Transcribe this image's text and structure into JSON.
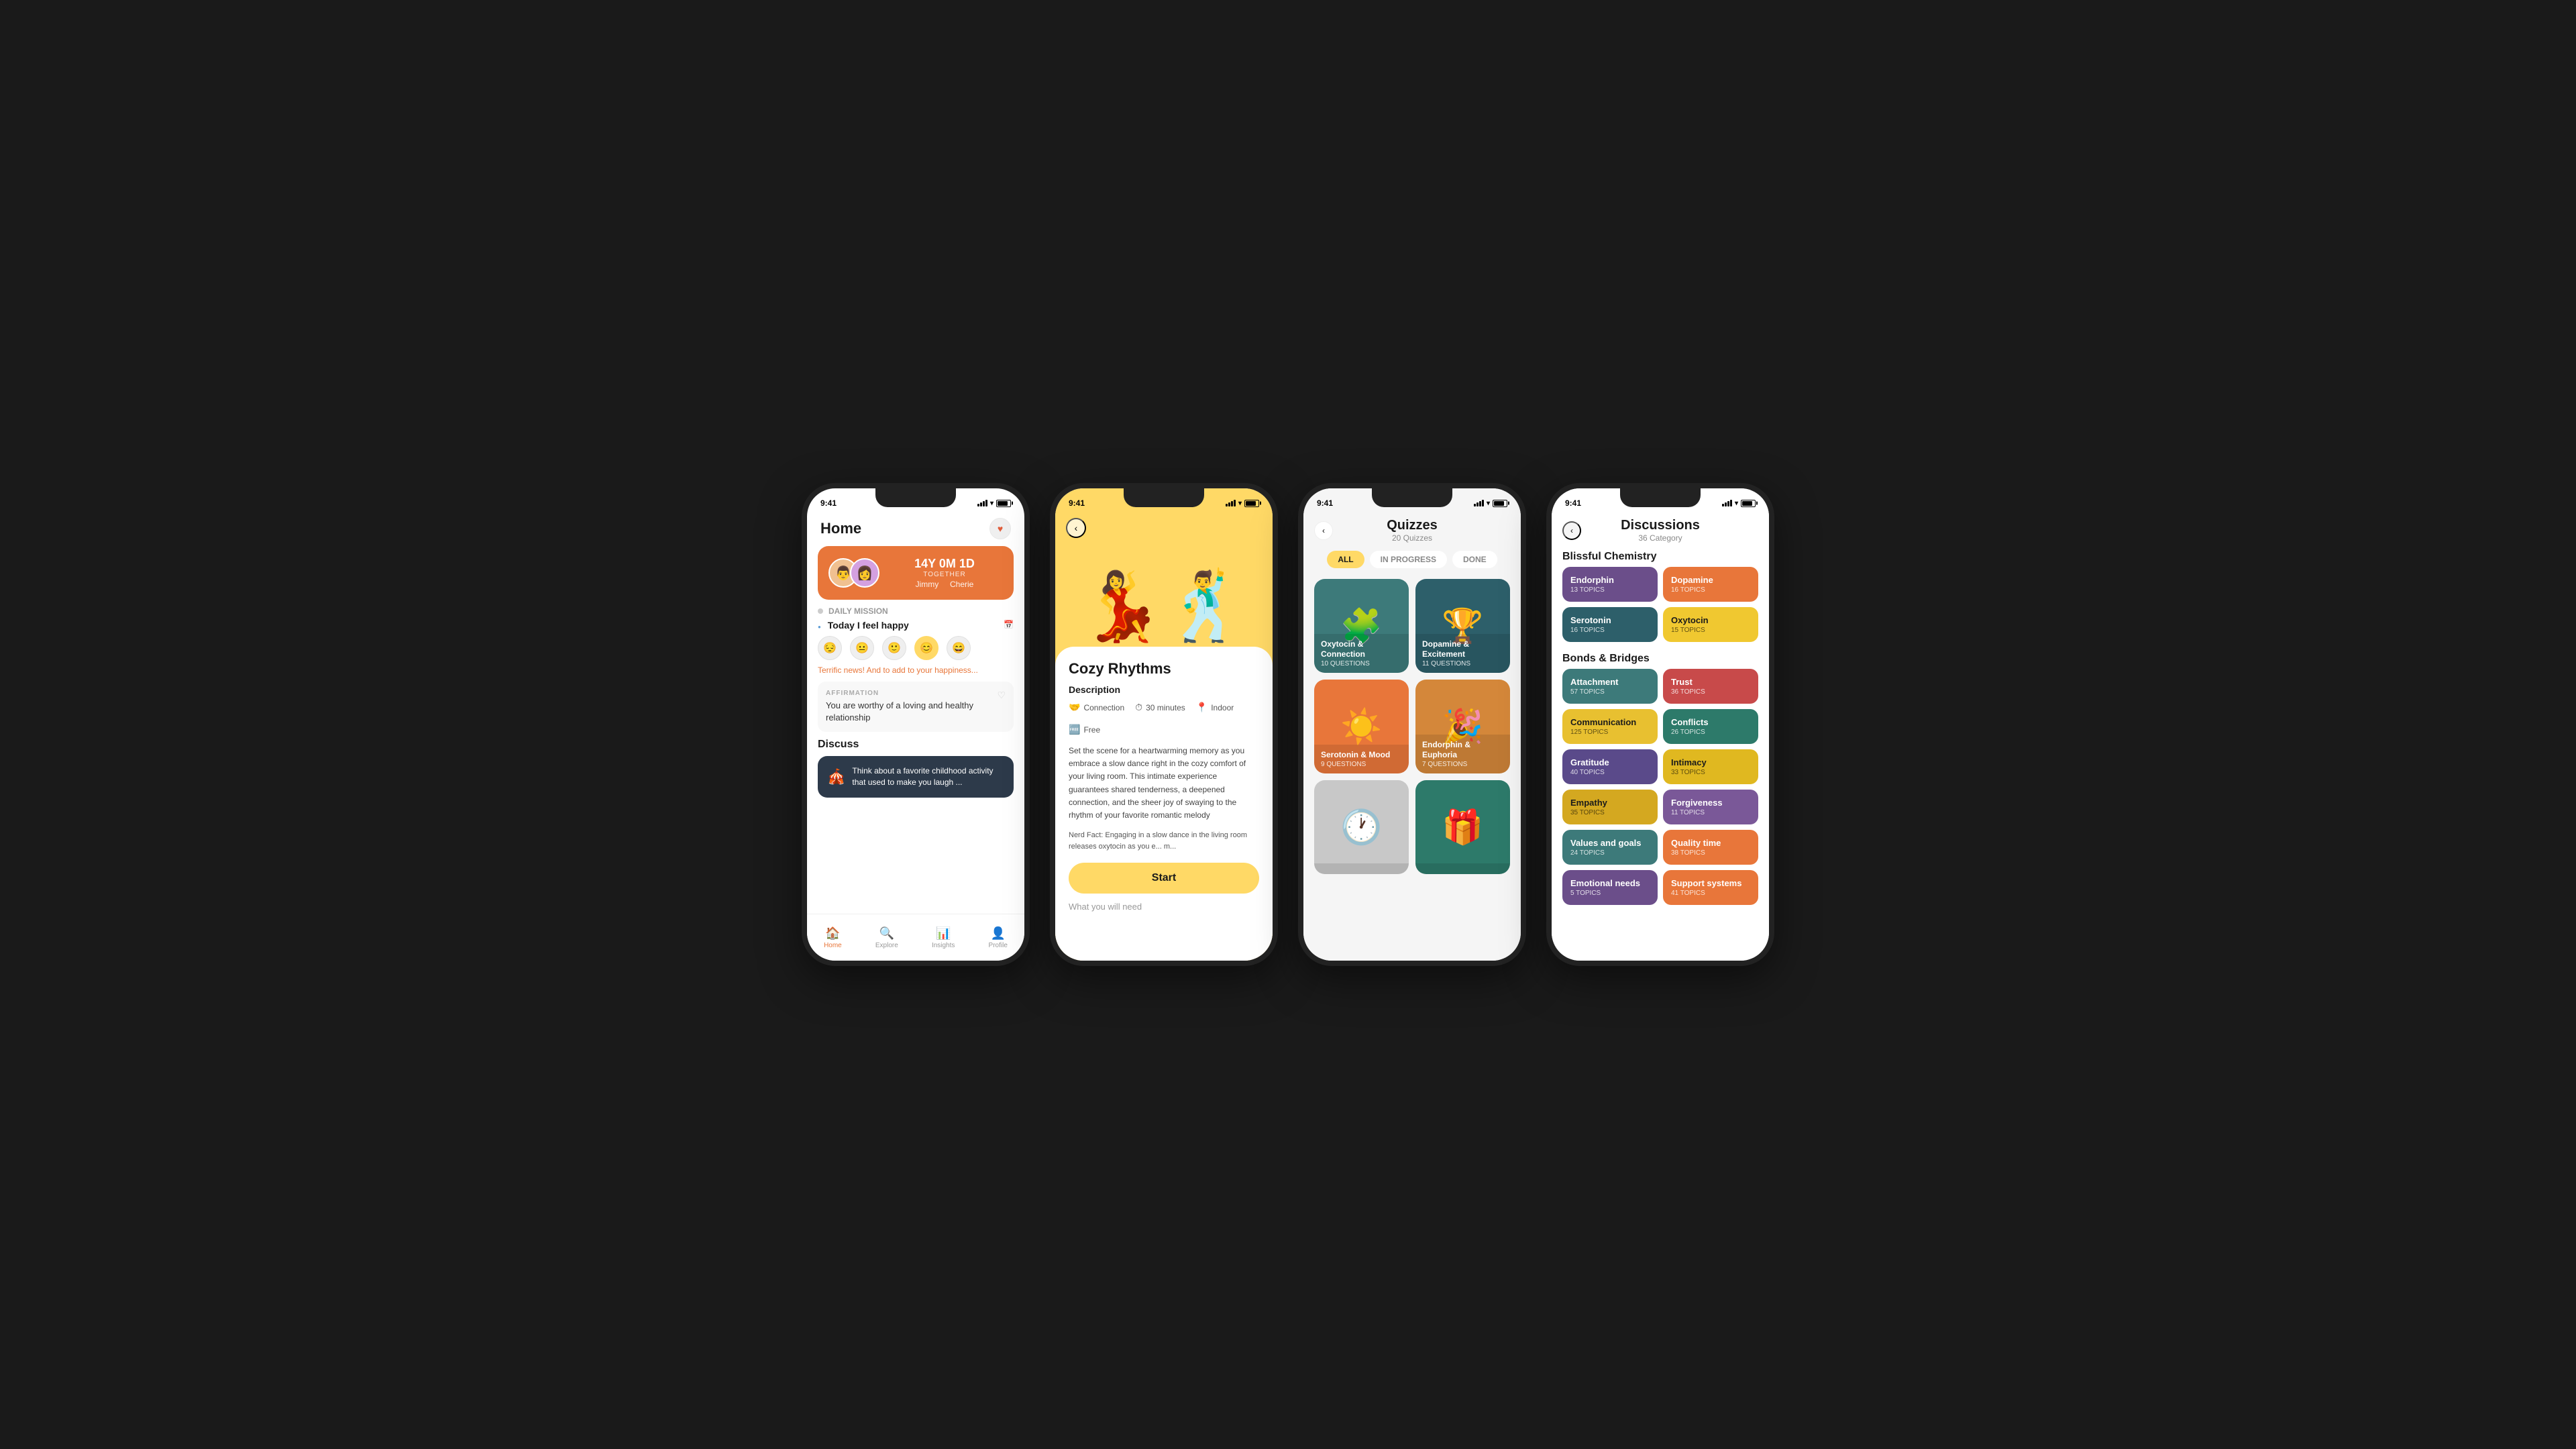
{
  "phones": {
    "phone1": {
      "statusBar": {
        "time": "9:41"
      },
      "header": {
        "title": "Home"
      },
      "coupleInfo": {
        "duration": "14Y 0M 1D",
        "together": "TOGETHER",
        "person1": "Jimmy",
        "person2": "Cherie"
      },
      "dailyMission": {
        "label": "DAILY MISSION",
        "moodLabel": "Today I feel happy",
        "terrificText": "Terrific news! And to add to your happiness...",
        "affirmation": {
          "label": "AFFIRMATION",
          "text": "You are worthy of a loving and healthy relationship"
        }
      },
      "discuss": {
        "title": "Discuss",
        "cardText": "Think about a favorite childhood activity that used to make you laugh ..."
      },
      "nav": {
        "items": [
          {
            "label": "Home",
            "icon": "🏠",
            "active": true
          },
          {
            "label": "Explore",
            "icon": "🔍",
            "active": false
          },
          {
            "label": "Insights",
            "icon": "📊",
            "active": false
          },
          {
            "label": "Profile",
            "icon": "👤",
            "active": false
          }
        ]
      }
    },
    "phone2": {
      "statusBar": {
        "time": "9:41"
      },
      "title": "Cozy Rhythms",
      "descriptionLabel": "Description",
      "tags": [
        {
          "icon": "🤝",
          "label": "Connection"
        },
        {
          "icon": "⏱",
          "label": "30 minutes"
        },
        {
          "icon": "📍",
          "label": "Indoor"
        },
        {
          "icon": "🆓",
          "label": "Free"
        }
      ],
      "description": "Set the scene for a heartwarming memory as you embrace a slow dance right in the cozy comfort of your living room. This intimate experience guarantees shared tenderness, a deepened connection, and the sheer joy of swaying to the rhythm of your favorite romantic melody",
      "nerdFact": "Nerd Fact: Engaging in a slow dance in the living room releases oxytocin as you e... m...",
      "startBtn": "Start",
      "whatNeed": "What you will need"
    },
    "phone3": {
      "statusBar": {
        "time": "9:41"
      },
      "title": "Quizzes",
      "subtitle": "20 Quizzes",
      "tabs": [
        "ALL",
        "IN PROGRESS",
        "DONE"
      ],
      "activeTab": "ALL",
      "quizCards": [
        {
          "title": "Oxytocin & Connection",
          "count": "10 QUESTIONS",
          "color": "teal",
          "icon": "🧩"
        },
        {
          "title": "Dopamine & Excitement",
          "count": "11 QUESTIONS",
          "color": "dark-teal",
          "icon": "🏆"
        },
        {
          "title": "Serotonin & Mood",
          "count": "9 QUESTIONS",
          "color": "orange",
          "icon": "☀️"
        },
        {
          "title": "Endorphin & Euphoria",
          "count": "7 QUESTIONS",
          "color": "yellow-orange",
          "icon": "🎉"
        },
        {
          "title": "",
          "count": "",
          "color": "light-gray",
          "icon": "🕐"
        },
        {
          "title": "",
          "count": "",
          "color": "teal-green",
          "icon": "🎁"
        }
      ]
    },
    "phone4": {
      "statusBar": {
        "time": "9:41"
      },
      "title": "Discussions",
      "subtitle": "36 Category",
      "sections": [
        {
          "title": "Blissful Chemistry",
          "cards": [
            {
              "title": "Endorphin",
              "count": "13 TOPICS",
              "color": "dc-purple"
            },
            {
              "title": "Dopamine",
              "count": "16 TOPICS",
              "color": "dc-orange"
            },
            {
              "title": "Serotonin",
              "count": "16 TOPICS",
              "color": "dc-dark-teal"
            },
            {
              "title": "Oxytocin",
              "count": "15 TOPICS",
              "color": "dc-yellow"
            }
          ]
        },
        {
          "title": "Bonds & Bridges",
          "cards": [
            {
              "title": "Attachment",
              "count": "57 TOPICS",
              "color": "dc-teal"
            },
            {
              "title": "Trust",
              "count": "36 TOPICS",
              "color": "dc-red"
            },
            {
              "title": "Communication",
              "count": "125 TOPICS",
              "color": "dc-yellow2"
            },
            {
              "title": "Conflicts",
              "count": "26 TOPICS",
              "color": "dc-teal2"
            },
            {
              "title": "Gratitude",
              "count": "40 TOPICS",
              "color": "dc-blue-purple"
            },
            {
              "title": "Intimacy",
              "count": "33 TOPICS",
              "color": "dc-yellow3"
            },
            {
              "title": "Empathy",
              "count": "35 TOPICS",
              "color": "dc-yellow4"
            },
            {
              "title": "Forgiveness",
              "count": "11 TOPICS",
              "color": "dc-purple2"
            },
            {
              "title": "Values and goals",
              "count": "24 TOPICS",
              "color": "dc-teal"
            },
            {
              "title": "Quality time",
              "count": "38 TOPICS",
              "color": "dc-orange"
            },
            {
              "title": "Emotional needs",
              "count": "5 TOPICS",
              "color": "dc-purple"
            },
            {
              "title": "Support systems",
              "count": "41 TOPICS",
              "color": "dc-orange"
            }
          ]
        }
      ]
    }
  }
}
